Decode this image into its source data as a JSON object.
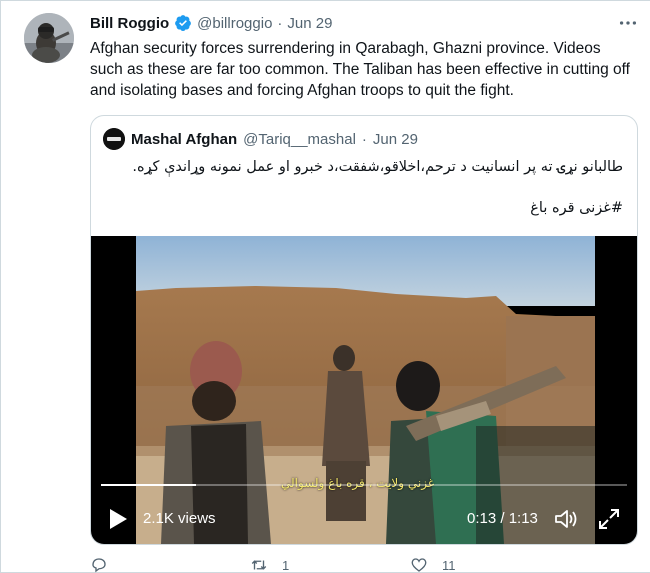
{
  "tweet": {
    "author_name": "Bill Roggio",
    "handle": "@billroggio",
    "separator": "·",
    "date": "Jun 29",
    "text": "Afghan security forces surrendering in Qarabagh, Ghazni province. Videos such as these are far too common. The Taliban has been effective in cutting off and isolating bases and forcing Afghan troops to quit the fight.",
    "avatar_icon": "profile-photo",
    "verified_icon": "verified-badge-icon",
    "more_icon": "more-horizontal-icon"
  },
  "quote": {
    "author_name": "Mashal Afghan",
    "handle": "@Tariq__mashal",
    "separator": "·",
    "date": "Jun 29",
    "text": "طالبانو نړۍ ته پر انسانیت د ترحم،اخلاقو،شفقت،د خبرو او عمل نمونه وړاندې کړه.",
    "hashtag": "#غزنی قره باغ"
  },
  "video": {
    "views": "2.1K views",
    "time": "0:13 / 1:13",
    "progress": 0.18,
    "caption": "غزني ولايت ، قره باغ ولسوالي",
    "play_icon": "play-icon",
    "volume_icon": "volume-icon",
    "fullscreen_icon": "fullscreen-icon"
  },
  "actions": {
    "reply_count": "",
    "retweet_count": "1",
    "like_count": "11"
  },
  "colors": {
    "accent": "#1d9bf0",
    "text_primary": "#0f1419",
    "text_secondary": "#536471",
    "border": "#cfd9de"
  }
}
